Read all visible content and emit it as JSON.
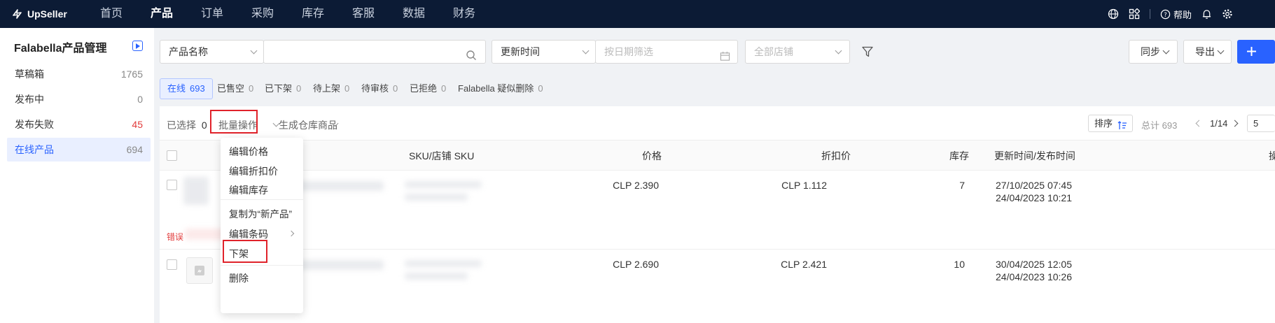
{
  "app": {
    "brand": "UpSeller",
    "nav": [
      "首页",
      "产品",
      "订单",
      "采购",
      "库存",
      "客服",
      "数据",
      "财务"
    ],
    "active_nav": "产品",
    "help_label": "帮助"
  },
  "sidebar": {
    "title": "Falabella产品管理",
    "items": [
      {
        "label": "草稿箱",
        "count": "1765"
      },
      {
        "label": "发布中",
        "count": "0"
      },
      {
        "label": "发布失败",
        "count": "45"
      },
      {
        "label": "在线产品",
        "count": "694"
      }
    ]
  },
  "filters": {
    "field_select": "产品名称",
    "search_value": "",
    "time_select": "更新时间",
    "date_placeholder": "按日期筛选",
    "store_placeholder": "全部店铺"
  },
  "actions": {
    "sync_label": "同步",
    "export_label": "导出"
  },
  "tabs": [
    {
      "label": "在线",
      "count": "693"
    },
    {
      "label": "已售空",
      "count": "0"
    },
    {
      "label": "已下架",
      "count": "0"
    },
    {
      "label": "待上架",
      "count": "0"
    },
    {
      "label": "待审核",
      "count": "0"
    },
    {
      "label": "已拒绝",
      "count": "0"
    },
    {
      "label": "Falabella 疑似删除",
      "count": "0"
    }
  ],
  "toolbar": {
    "selected_label": "已选择",
    "selected_count": "0",
    "bulk_label": "批量操作",
    "warehouse_label": "生成仓库商品",
    "sort_label": "排序",
    "total_label": "总计 693",
    "page_info": "1/14",
    "page_size": "5"
  },
  "bulk_menu": [
    "编辑价格",
    "编辑折扣价",
    "编辑库存",
    "复制为“新产品”",
    "编辑条码",
    "下架",
    "删除"
  ],
  "table": {
    "columns": [
      "SKU/店铺 SKU",
      "价格",
      "折扣价",
      "库存",
      "更新时间/发布时间",
      "操"
    ],
    "rows": [
      {
        "price": "CLP 2.390",
        "discount": "CLP 1.112",
        "stock": "7",
        "updated": "27/10/2025 07:45",
        "published": "24/04/2023 10:21",
        "error": "错误"
      },
      {
        "price": "CLP 2.690",
        "discount": "CLP 2.421",
        "stock": "10",
        "updated": "30/04/2025 12:05",
        "published": "24/04/2023 10:26",
        "error": ""
      }
    ]
  },
  "colors": {
    "accent": "#2962ff",
    "nav_bg": "#0c1b35",
    "highlight": "#e0222a"
  }
}
